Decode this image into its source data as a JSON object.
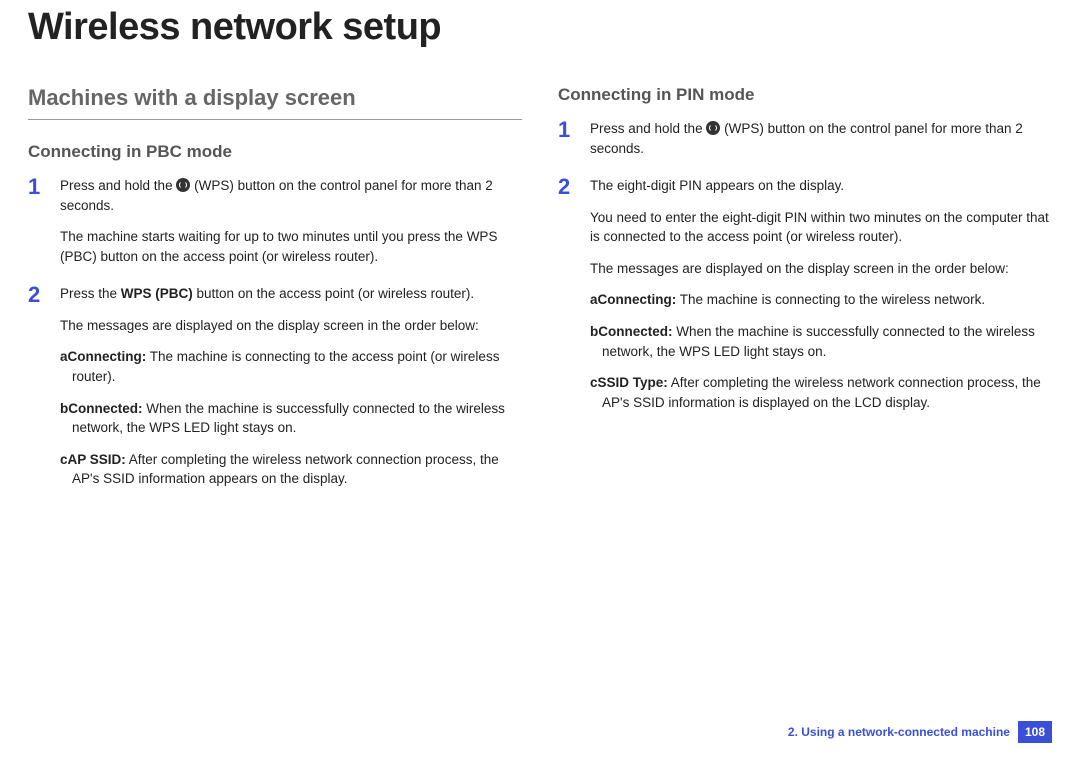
{
  "title": "Wireless network setup",
  "left": {
    "h2": "Machines with a display screen",
    "h3": "Connecting in PBC mode",
    "step1": {
      "p1a": "Press and hold the ",
      "p1b": " (WPS) button on the control panel for more than 2 seconds.",
      "p2": "The machine starts waiting for up to two minutes until you press the WPS (PBC) button on the access point (or wireless router)."
    },
    "step2": {
      "p1a": "Press the ",
      "p1b_bold": "WPS (PBC)",
      "p1c": " button on the access point (or wireless router).",
      "p2": "The messages are displayed on the display screen in the order below:",
      "a_label": "a",
      "a_bold": "Connecting:",
      "a_text": " The machine is connecting to the access point (or wireless router).",
      "b_label": "b",
      "b_bold": "Connected:",
      "b_text": " When the machine is successfully connected to the wireless network, the WPS LED light stays on.",
      "c_label": "c",
      "c_bold": "AP SSID:",
      "c_text": " After completing the wireless network connection process, the AP's SSID information appears on the display."
    }
  },
  "right": {
    "h3": "Connecting in PIN mode",
    "step1": {
      "p1a": "Press and hold the ",
      "p1b": " (WPS) button on the control panel for more than 2 seconds."
    },
    "step2": {
      "p1": "The eight-digit PIN appears on the display.",
      "p2": "You need to enter the eight-digit PIN within two minutes on the computer that is connected to the access point (or wireless router).",
      "p3": "The messages are displayed on the display screen in the order below:",
      "a_label": "a",
      "a_bold": "Connecting:",
      "a_text": " The machine is connecting to the wireless network.",
      "b_label": "b",
      "b_bold": "Connected:",
      "b_text": " When the machine is successfully connected to the wireless network, the WPS LED light stays on.",
      "c_label": "c",
      "c_bold": "SSID Type:",
      "c_text": " After completing the wireless network connection process, the AP's SSID information is displayed on the LCD display."
    }
  },
  "footer": {
    "chapter": "2.  Using a network-connected machine",
    "page": "108"
  }
}
